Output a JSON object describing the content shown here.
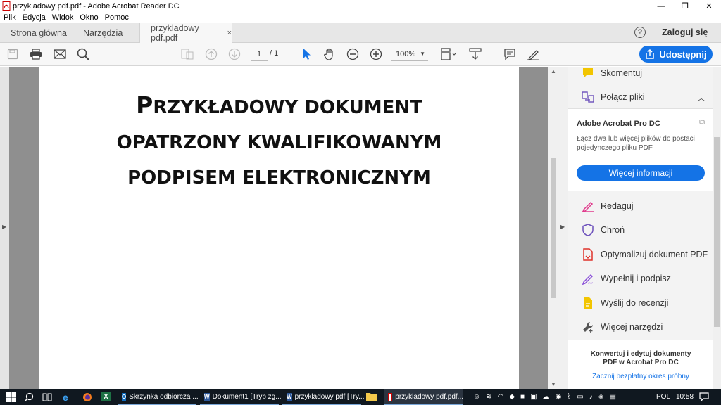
{
  "window": {
    "title": "przykladowy pdf.pdf - Adobe Acrobat Reader DC",
    "minimize": "—",
    "restore": "❐",
    "close": "✕"
  },
  "menu": [
    "Plik",
    "Edycja",
    "Widok",
    "Okno",
    "Pomoc"
  ],
  "tabs": {
    "home": "Strona główna",
    "tools": "Narzędzia",
    "document": "przykladowy pdf.pdf",
    "close": "×"
  },
  "account": {
    "help": "?",
    "login": "Zaloguj się"
  },
  "toolbar": {
    "page_current": "1",
    "page_total": "/ 1",
    "zoom": "100%",
    "share": "Udostępnij"
  },
  "document": {
    "title_lines": [
      "Przykładowy dokument",
      "opatrzony kwalifikowanym",
      "podpisem elektronicznym"
    ]
  },
  "panel": {
    "comment": "Skomentuj",
    "combine": "Połącz pliki",
    "card_title": "Adobe Acrobat Pro DC",
    "card_desc": "Łącz dwa lub więcej plików do postaci pojedynczego pliku PDF",
    "card_button": "Więcej informacji",
    "tools": [
      "Redaguj",
      "Chroń",
      "Optymalizuj dokument PDF",
      "Wypełnij i podpisz",
      "Wyślij do recenzji",
      "Więcej narzędzi"
    ],
    "promo_text": "Konwertuj i edytuj dokumenty PDF w Acrobat Pro DC",
    "promo_link": "Zacznij bezpłatny okres próbny"
  },
  "taskbar": {
    "apps": [
      "Skrzynka odbiorcza ...",
      "Dokument1 [Tryb zg...",
      "przykladowy pdf [Try...",
      "przykladowy pdf.pdf..."
    ],
    "lang": "POL",
    "time": "10:58"
  },
  "colors": {
    "accent": "#1473e6",
    "taskbar": "#101820",
    "viewer_bg": "#8f8f8f"
  }
}
